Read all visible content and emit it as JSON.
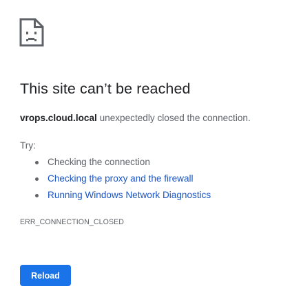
{
  "error_page": {
    "icon": "sad-page-icon",
    "title": "This site can’t be reached",
    "host": "vrops.cloud.local",
    "message_suffix": " unexpectedly closed the connection.",
    "try_label": "Try:",
    "suggestions": [
      {
        "label": "Checking the connection",
        "is_link": false
      },
      {
        "label": "Checking the proxy and the firewall",
        "is_link": true
      },
      {
        "label": "Running Windows Network Diagnostics",
        "is_link": true
      }
    ],
    "error_code": "ERR_CONNECTION_CLOSED",
    "reload_label": "Reload"
  },
  "colors": {
    "link": "#1a55c6",
    "button": "#1a73e8",
    "text": "#5f6368",
    "heading": "#202124"
  }
}
